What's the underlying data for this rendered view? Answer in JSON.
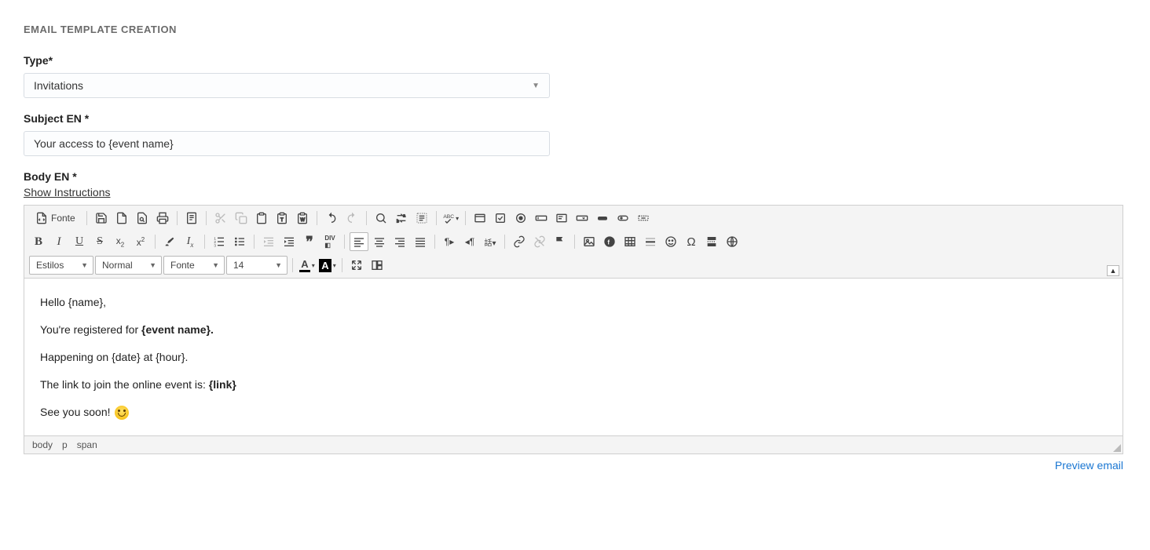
{
  "page": {
    "title": "EMAIL TEMPLATE CREATION"
  },
  "fields": {
    "type": {
      "label": "Type*",
      "value": "Invitations"
    },
    "subject": {
      "label": "Subject EN *",
      "value": "Your access to {event name}"
    },
    "body": {
      "label": "Body EN *",
      "show_instructions": "Show Instructions"
    }
  },
  "toolbar": {
    "source_label": "Fonte",
    "styles_dd": "Estilos",
    "format_dd": "Normal",
    "font_dd": "Fonte",
    "size_dd": "14",
    "text_color": "A",
    "bg_color": "A"
  },
  "editor_content": {
    "line1": "Hello {name},",
    "line2_a": "You're registered for ",
    "line2_b": "{event name}.",
    "line3": "Happening on {date} at {hour}.",
    "line4_a": "The link to join the online event is: ",
    "line4_b": "{link}",
    "line5": "See you soon! "
  },
  "path_bar": {
    "p1": "body",
    "p2": "p",
    "p3": "span"
  },
  "footer": {
    "preview_link": "Preview email"
  }
}
